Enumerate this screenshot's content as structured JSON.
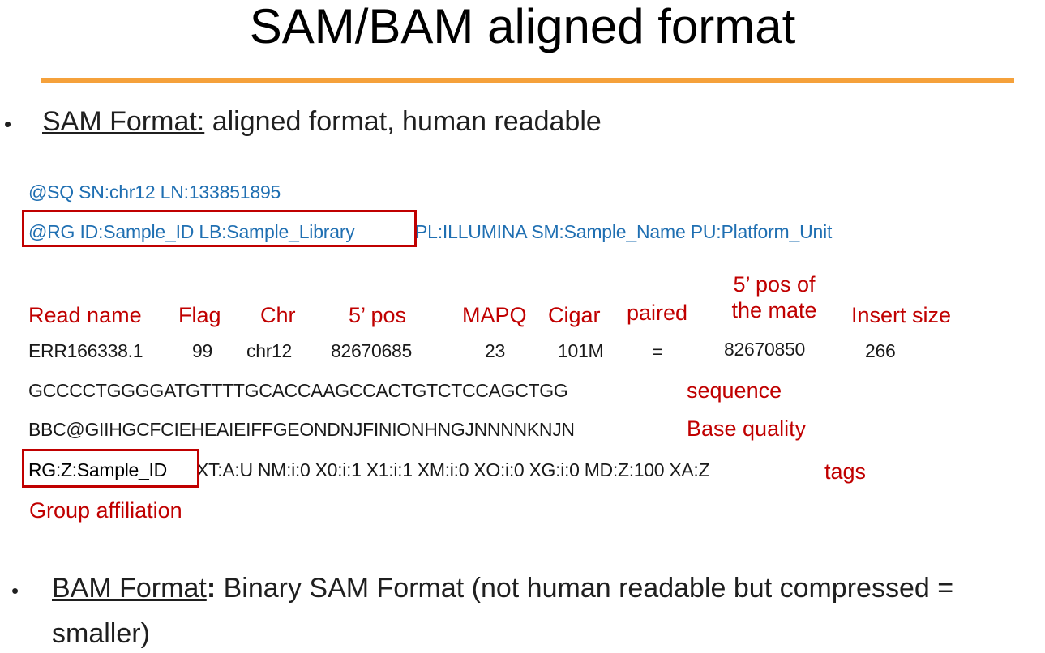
{
  "title": "SAM/BAM aligned format",
  "sam_bullet": {
    "bullet": "•",
    "term": "SAM Format:",
    "rest": " aligned format, human readable"
  },
  "header_lines": {
    "sq": "@SQ SN:chr12 LN:133851895",
    "rg_boxed": "@RG ID:Sample_ID LB:Sample_Library",
    "rg_rest": "PL:ILLUMINA SM:Sample_Name PU:Platform_Unit"
  },
  "column_labels": {
    "read_name": "Read name",
    "flag": "Flag",
    "chr": "Chr",
    "pos": "5’ pos",
    "mapq": "MAPQ",
    "cigar": "Cigar",
    "paired": "paired",
    "mate_pos_line1": "5’ pos of",
    "mate_pos_line2": "the mate",
    "insert_size": "Insert size"
  },
  "record": {
    "read_name": "ERR166338.1",
    "flag": "99",
    "chr": "chr12",
    "pos": "82670685",
    "mapq": "23",
    "cigar": "101M",
    "paired": "=",
    "mate_pos": "82670850",
    "insert_size": "266",
    "sequence": "GCCCCTGGGGATGTTTTGCACCAAGCCACTGTCTCCAGCTGG",
    "quality": "BBC@GIIHGCFCIEHEAIEIFFGEONDNJFINIONHNGJNNNNKNJN",
    "tag_boxed": "RG:Z:Sample_ID",
    "tags_rest": "XT:A:U NM:i:0 X0:i:1 X1:i:1 XM:i:0 XO:i:0 XG:i:0 MD:Z:100 XA:Z"
  },
  "annotations": {
    "sequence": "sequence",
    "quality": "Base quality",
    "tags": "tags",
    "group_affiliation": "Group affiliation"
  },
  "bam_bullet": {
    "bullet": "•",
    "term": "BAM Format",
    "colon": ":",
    "rest_line1": " Binary SAM Format (not human readable but compressed =",
    "rest_line2": "smaller)"
  },
  "colors": {
    "accent_rule": "#f5a13b",
    "header_blue": "#1f6fb2",
    "annotation_red": "#c00000"
  }
}
